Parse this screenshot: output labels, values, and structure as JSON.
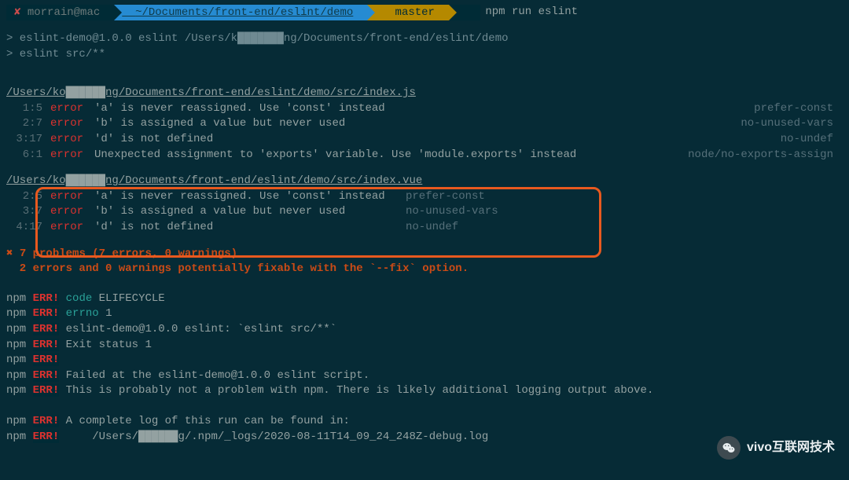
{
  "prompt": {
    "x": "✘",
    "user": "morrain@mac",
    "path": "~/Documents/front-end/eslint/demo",
    "branch_icon": " ",
    "branch": "master",
    "command": "npm run eslint"
  },
  "echo": {
    "line1": "> eslint-demo@1.0.0 eslint /Users/k███████ng/Documents/front-end/eslint/demo",
    "line2": "> eslint src/**"
  },
  "files": [
    {
      "path": "/Users/ko██████ng/Documents/front-end/eslint/demo/src/index.js",
      "errors": [
        {
          "loc": "1:5",
          "label": "error",
          "msg": "'a' is never reassigned. Use 'const' instead",
          "rule": "prefer-const"
        },
        {
          "loc": "2:7",
          "label": "error",
          "msg": "'b' is assigned a value but never used",
          "rule": "no-unused-vars"
        },
        {
          "loc": "3:17",
          "label": "error",
          "msg": "'d' is not defined",
          "rule": "no-undef"
        },
        {
          "loc": "6:1",
          "label": "error",
          "msg": "Unexpected assignment to 'exports' variable. Use 'module.exports' instead",
          "rule": "node/no-exports-assign"
        }
      ]
    },
    {
      "path": "/Users/ko██████ng/Documents/front-end/eslint/demo/src/index.vue",
      "errors": [
        {
          "loc": "2:5",
          "label": "error",
          "msg": "'a' is never reassigned. Use 'const' instead",
          "rule": "prefer-const"
        },
        {
          "loc": "3:7",
          "label": "error",
          "msg": "'b' is assigned a value but never used",
          "rule": "no-unused-vars"
        },
        {
          "loc": "4:17",
          "label": "error",
          "msg": "'d' is not defined",
          "rule": "no-undef"
        }
      ]
    }
  ],
  "summary": {
    "line1": "✖ 7 problems (7 errors, 0 warnings)",
    "line2": "  2 errors and 0 warnings potentially fixable with the `--fix` option."
  },
  "npm": [
    {
      "pre": "npm",
      "err": "ERR!",
      "cls": "cyan",
      "rest": " code ELIFECYCLE",
      "key": "code",
      "val": "ELIFECYCLE"
    },
    {
      "pre": "npm",
      "err": "ERR!",
      "cls": "cyan",
      "rest": " errno 1",
      "key": "errno",
      "val": "1"
    },
    {
      "pre": "npm",
      "err": "ERR!",
      "cls": "",
      "rest": " eslint-demo@1.0.0 eslint: `eslint src/**`"
    },
    {
      "pre": "npm",
      "err": "ERR!",
      "cls": "",
      "rest": " Exit status 1"
    },
    {
      "pre": "npm",
      "err": "ERR!",
      "cls": "",
      "rest": ""
    },
    {
      "pre": "npm",
      "err": "ERR!",
      "cls": "",
      "rest": " Failed at the eslint-demo@1.0.0 eslint script."
    },
    {
      "pre": "npm",
      "err": "ERR!",
      "cls": "",
      "rest": " This is probably not a problem with npm. There is likely additional logging output above."
    },
    {
      "blank": true
    },
    {
      "pre": "npm",
      "err": "ERR!",
      "cls": "",
      "rest": " A complete log of this run can be found in:"
    },
    {
      "pre": "npm",
      "err": "ERR!",
      "cls": "",
      "rest": "     /Users/██████g/.npm/_logs/2020-08-11T14_09_24_248Z-debug.log"
    }
  ],
  "watermark": {
    "icon": "Ⓦ",
    "text": "vivo互联网技术"
  }
}
